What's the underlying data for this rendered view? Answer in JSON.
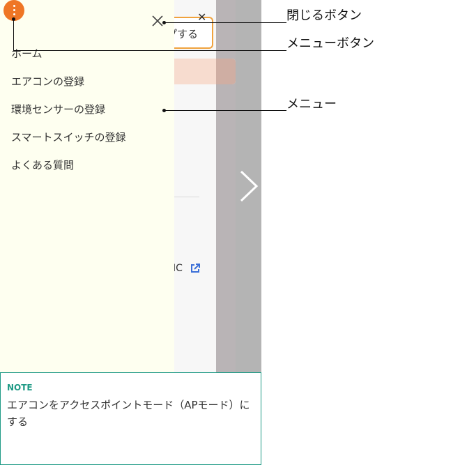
{
  "background_app": {
    "button_text": "プする",
    "close_glyph": "✕",
    "link_text": "IC",
    "next_icon": "chevron-right-icon",
    "external_link_icon": "external-link-icon"
  },
  "drawer": {
    "menu_button_icon": "kebab-menu-icon",
    "close_button_icon": "close-icon",
    "items": [
      {
        "label": "ホーム"
      },
      {
        "label": "エアコンの登録"
      },
      {
        "label": "環境センサーの登録"
      },
      {
        "label": "スマートスイッチの登録"
      },
      {
        "label": "よくある質問"
      }
    ]
  },
  "annotations": {
    "close_button": "閉じるボタン",
    "menu_button": "メニューボタン",
    "menu": "メニュー"
  },
  "note": {
    "label": "NOTE",
    "text": "エアコンをアクセスポイントモード（APモード）にする"
  },
  "colors": {
    "accent_orange": "#ef7625",
    "drawer_bg": "#fefff0",
    "note_teal": "#1e9a85",
    "link_blue": "#3b6fd8"
  }
}
